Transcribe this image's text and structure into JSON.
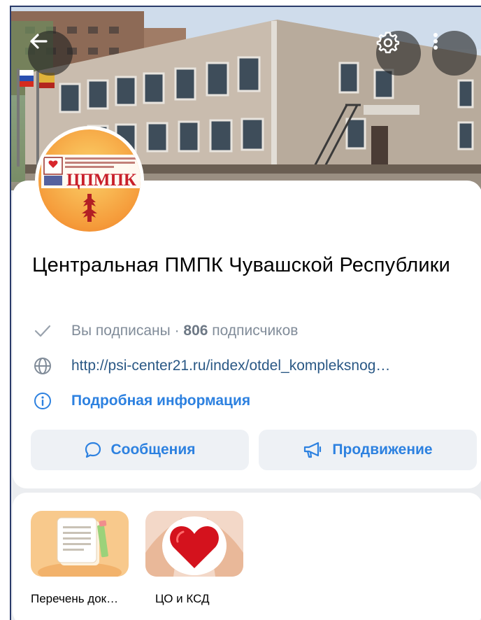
{
  "header": {
    "back_icon": "arrow-left-icon",
    "settings_icon": "gear-icon",
    "more_icon": "more-vertical-icon"
  },
  "avatar": {
    "logo_text": "ЦПМПК"
  },
  "community": {
    "name": "Центральная ПМПК Чувашской Республики",
    "subscribed_label": "Вы подписаны · ",
    "subscriber_count": "806",
    "subscriber_suffix": " подписчиков",
    "link": "http://psi-center21.ru/index/otdel_kompleksnog…",
    "info_label": "Подробная информация"
  },
  "actions": {
    "messages_label": "Сообщения",
    "promotion_label": "Продвижение"
  },
  "stories": [
    {
      "caption": "Перечень док…",
      "icon": "document-icon"
    },
    {
      "caption": "ЦО и КСД",
      "icon": "heart-icon"
    }
  ],
  "colors": {
    "accent": "#2d81e0",
    "link": "#2a5885",
    "secondary": "#818c99",
    "button_bg": "#eef1f5"
  }
}
